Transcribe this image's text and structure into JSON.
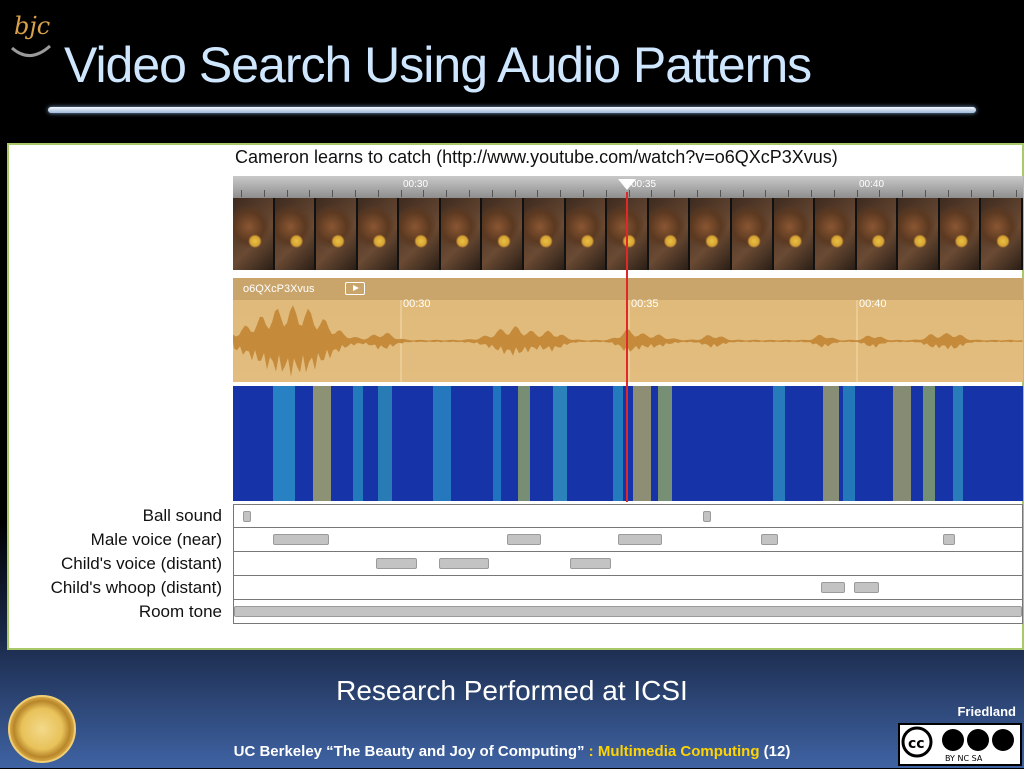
{
  "slide": {
    "logo_text": "bjc",
    "title": "Video Search Using Audio Patterns",
    "subtitle": "Research Performed at ICSI",
    "credit": "Friedland",
    "footer_main": "UC Berkeley “The Beauty and Joy of Computing”",
    "footer_sep": " : ",
    "footer_topic": "Multimedia Computing",
    "footer_page": " (12)",
    "license_text": "BY  NC  SA"
  },
  "figure": {
    "caption": "Cameron learns to catch (http://www.youtube.com/watch?v=o6QXcP3Xvus)",
    "timeline_labels": [
      "00:30",
      "00:35",
      "00:40"
    ],
    "audio_track_name": "o6QXcP3Xvus",
    "audio_labels": [
      "00:30",
      "00:35",
      "00:40"
    ],
    "rows": [
      {
        "label": "Ball sound",
        "segments": [
          [
            0.012,
            0.022
          ],
          [
            0.595,
            0.605
          ]
        ]
      },
      {
        "label": "Male voice (near)",
        "segments": [
          [
            0.05,
            0.12
          ],
          [
            0.347,
            0.39
          ],
          [
            0.487,
            0.543
          ],
          [
            0.669,
            0.69
          ],
          [
            0.9,
            0.915
          ]
        ]
      },
      {
        "label": "Child's voice (distant)",
        "segments": [
          [
            0.18,
            0.232
          ],
          [
            0.26,
            0.324
          ],
          [
            0.427,
            0.479
          ]
        ]
      },
      {
        "label": "Child's whoop (distant)",
        "segments": [
          [
            0.745,
            0.775
          ],
          [
            0.787,
            0.818
          ]
        ]
      },
      {
        "label": "Room tone",
        "segments": [
          [
            0.0,
            1.0
          ]
        ]
      }
    ]
  }
}
